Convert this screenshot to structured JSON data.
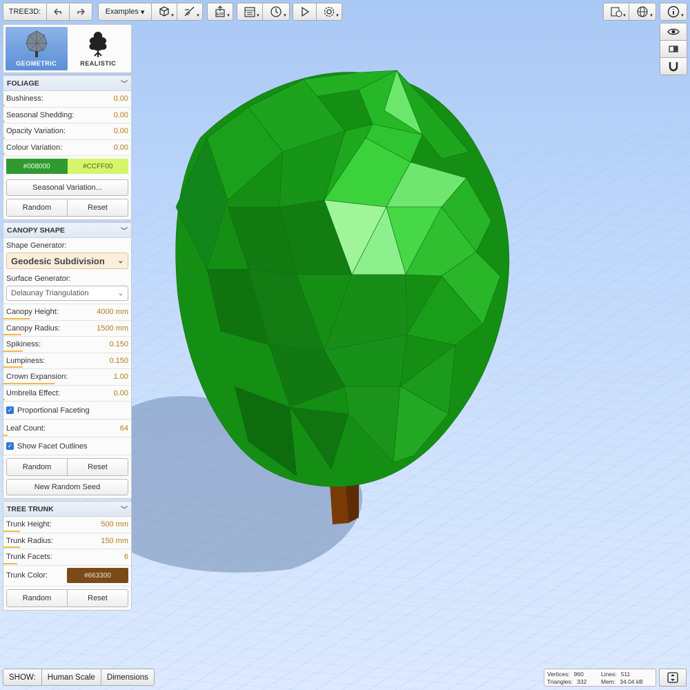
{
  "app": {
    "title": "TREE3D:"
  },
  "toolbar": {
    "examples_label": "Examples"
  },
  "modes": [
    {
      "label": "GEOMETRIC",
      "active": true
    },
    {
      "label": "REALISTIC",
      "active": false
    }
  ],
  "foliage": {
    "title": "FOLIAGE",
    "rows": [
      {
        "label": "Bushiness:",
        "value": "0.00"
      },
      {
        "label": "Seasonal Shedding:",
        "value": "0.00"
      },
      {
        "label": "Opacity Variation:",
        "value": "0.00"
      },
      {
        "label": "Colour Variation:",
        "value": "0.00"
      }
    ],
    "color_start": "#008000",
    "color_end": "#CCFF00",
    "seasonal_button": "Seasonal Variation...",
    "random": "Random",
    "reset": "Reset"
  },
  "canopy": {
    "title": "CANOPY SHAPE",
    "shape_generator_label": "Shape Generator:",
    "shape_generator_value": "Geodesic Subdivision",
    "surface_generator_label": "Surface Generator:",
    "surface_generator_value": "Delaunay Triangulation",
    "rows": [
      {
        "label": "Canopy Height:",
        "value": "4000 mm",
        "fill": 0.2
      },
      {
        "label": "Canopy Radius:",
        "value": "1500 mm",
        "fill": 0.14
      },
      {
        "label": "Spikiness:",
        "value": "0.150",
        "fill": 0.15
      },
      {
        "label": "Lumpiness:",
        "value": "0.150",
        "fill": 0.15
      },
      {
        "label": "Crown Expansion:",
        "value": "1.00",
        "fill": 0.4
      },
      {
        "label": "Umbrella Effect:",
        "value": "0.00",
        "fill": 0.0
      }
    ],
    "proportional_faceting": "Proportional Faceting",
    "leaf_count_label": "Leaf Count:",
    "leaf_count_value": "64",
    "show_outlines": "Show Facet Outlines",
    "random": "Random",
    "reset": "Reset",
    "new_seed": "New Random Seed"
  },
  "trunk": {
    "title": "TREE TRUNK",
    "rows": [
      {
        "label": "Trunk Height:",
        "value": "500 mm",
        "fill": 0.13
      },
      {
        "label": "Trunk Radius:",
        "value": "150 mm",
        "fill": 0.13
      },
      {
        "label": "Trunk Facets:",
        "value": "6",
        "fill": 0.1
      }
    ],
    "color_label": "Trunk Color:",
    "color_value": "#663300",
    "random": "Random",
    "reset": "Reset"
  },
  "show": {
    "label": "SHOW:",
    "human_scale": "Human Scale",
    "dimensions": "Dimensions"
  },
  "stats": {
    "vertices_label": "Vertices:",
    "vertices": "960",
    "lines_label": "Lines:",
    "lines": "511",
    "triangles_label": "Triangles:",
    "triangles": "332",
    "mem_label": "Mem:",
    "mem": "34.04 kB"
  },
  "icons": {
    "undo": "undo-icon",
    "redo": "redo-icon",
    "play": "play-icon",
    "settings": "gear-icon"
  }
}
